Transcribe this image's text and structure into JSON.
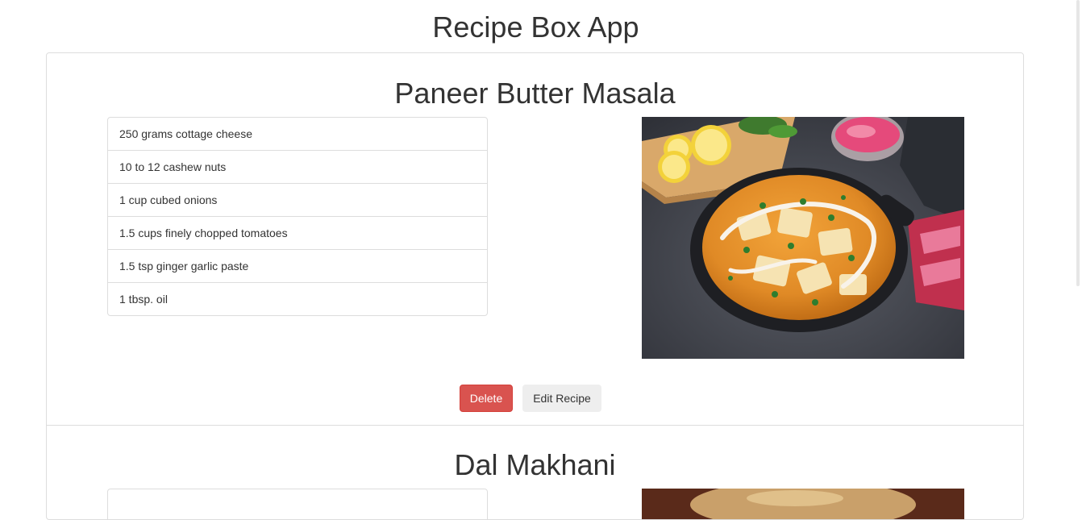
{
  "app": {
    "title": "Recipe Box App"
  },
  "recipes": [
    {
      "title": "Paneer Butter Masala",
      "ingredients": [
        "250 grams cottage cheese",
        "10 to 12 cashew nuts",
        "1 cup cubed onions",
        "1.5 cups finely chopped tomatoes",
        "1.5 tsp ginger garlic paste",
        "1 tbsp. oil"
      ],
      "image_icon": "paneer-butter-masala-photo",
      "actions": {
        "delete_label": "Delete",
        "edit_label": "Edit Recipe"
      }
    },
    {
      "title": "Dal Makhani",
      "image_icon": "dal-makhani-photo"
    }
  ],
  "colors": {
    "delete_button": "#d9534f",
    "edit_button": "#eeeeee",
    "border": "#dddddd",
    "text": "#333333"
  }
}
